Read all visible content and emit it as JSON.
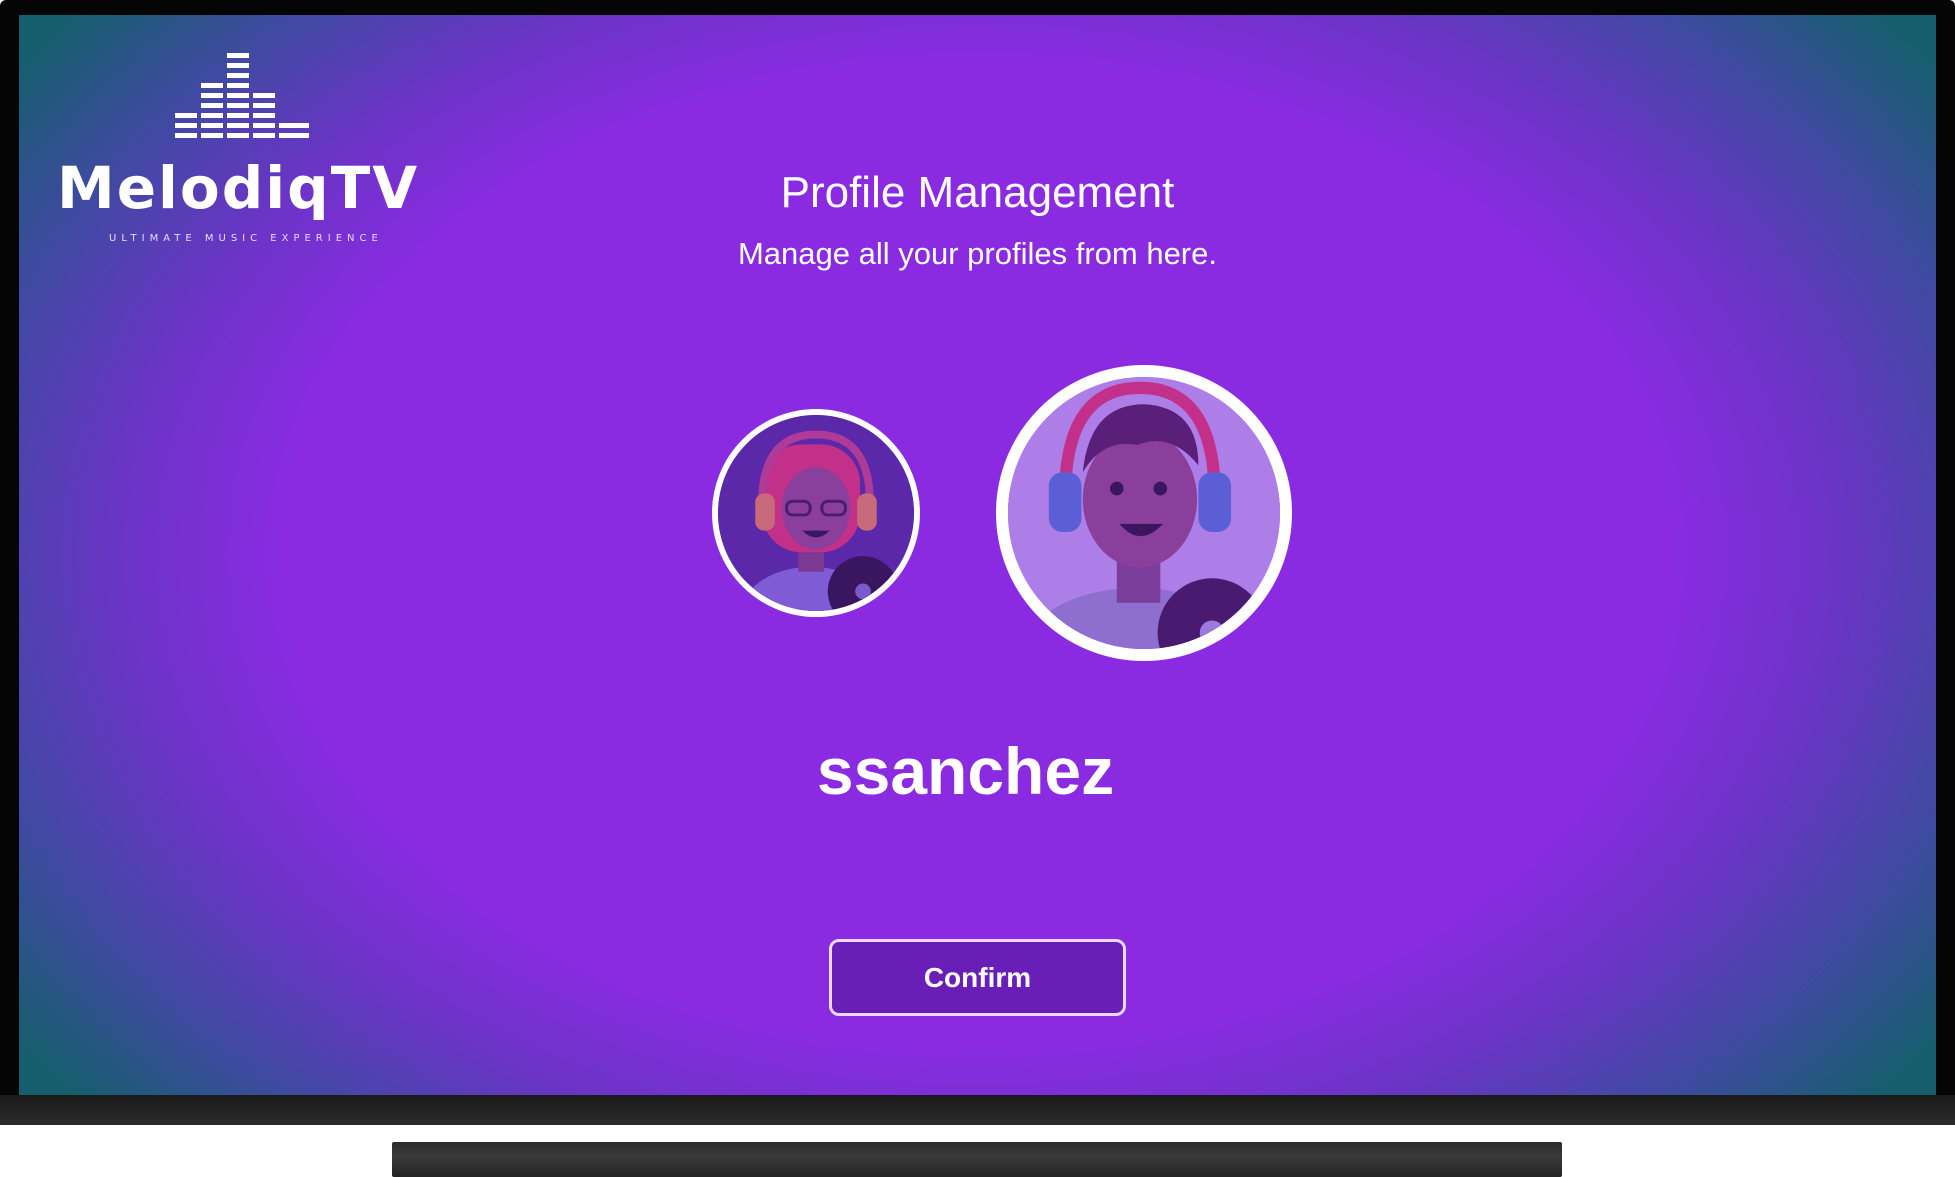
{
  "brand": {
    "name": "MelodiqTV",
    "tagline": "ULTIMATE MUSIC EXPERIENCE",
    "logo_icon": "equalizer-bars-icon"
  },
  "header": {
    "title": "Profile Management",
    "subtitle": "Manage all your profiles from here."
  },
  "profiles": [
    {
      "avatar": "female-listener-with-headphones-avatar",
      "selected": false,
      "edit_icon": "pencil-icon"
    },
    {
      "avatar": "male-listener-with-headphones-avatar",
      "selected": true,
      "edit_icon": "pencil-icon"
    }
  ],
  "selected_profile": {
    "username": "ssanchez"
  },
  "actions": {
    "confirm_label": "Confirm"
  },
  "colors": {
    "background_center": "#8a2be2",
    "background_edge": "#145f6b",
    "button_fill": "#6a1eb8",
    "text": "#ffffff"
  }
}
